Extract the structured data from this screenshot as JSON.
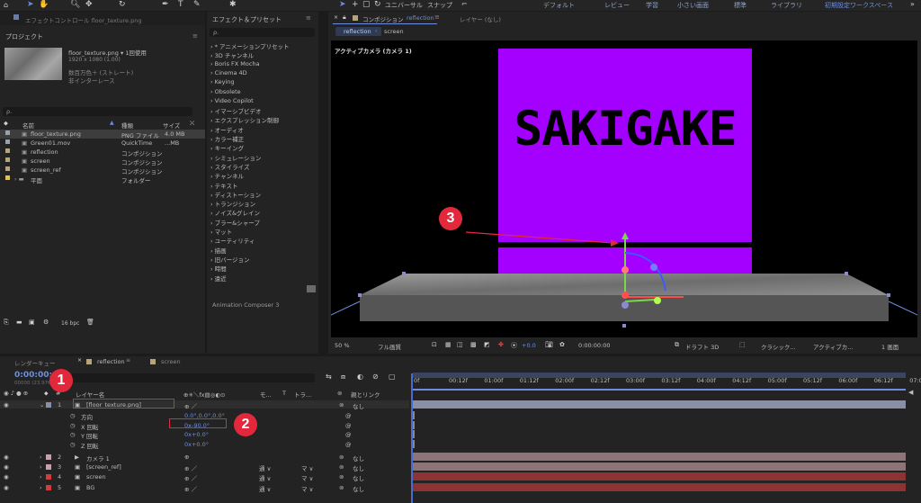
{
  "topbar": {
    "menu_universal": "ユニバーサル",
    "menu_snap": "スナップ",
    "workspaces": [
      "デフォルト",
      "レビュー",
      "学習",
      "小さい画面",
      "標準",
      "ライブラリ",
      "初期設定ワークスペース"
    ],
    "effect_control_tab": "エフェクトコントロール floor_texture.png"
  },
  "project": {
    "title": "プロジェクト",
    "file_name": "floor_texture.png ▾ 1回使用",
    "file_res": "1920 x 1080 (1.00)",
    "file_color": "数百万色＋ (ストレート)",
    "file_interlace": "非インターレース",
    "search_placeholder": "ρ.",
    "columns": {
      "name": "名前",
      "type": "種類",
      "size": "サイズ"
    },
    "items": [
      {
        "name": "floor_texture.png",
        "type": "PNG ファイル",
        "size": "4.0 MB",
        "color": "#9aa0ad",
        "selected": true
      },
      {
        "name": "Green01.mov",
        "type": "QuickTime",
        "size": "...MB",
        "color": "#9aa0ad"
      },
      {
        "name": "reflection",
        "type": "コンポジション",
        "size": "",
        "color": "#b8a47a"
      },
      {
        "name": "screen",
        "type": "コンポジション",
        "size": "",
        "color": "#b8a47a"
      },
      {
        "name": "screen_ref",
        "type": "コンポジション",
        "size": "",
        "color": "#b8a47a"
      },
      {
        "name": "平面",
        "type": "フォルダー",
        "size": "",
        "color": "#e0c34a"
      }
    ],
    "bpc": "16 bpc"
  },
  "effects": {
    "title": "エフェクト＆プリセット",
    "search_placeholder": "ρ.",
    "items": [
      "* アニメーションプリセット",
      "3D チャンネル",
      "Boris FX Mocha",
      "Cinema 4D",
      "Keying",
      "Obsolete",
      "Video Copilot",
      "イマーシブビデオ",
      "エクスプレッション制御",
      "オーディオ",
      "カラー補正",
      "キーイング",
      "シミュレーション",
      "スタイライズ",
      "チャンネル",
      "テキスト",
      "ディストーション",
      "トランジション",
      "ノイズ&グレイン",
      "ブラー&シャープ",
      "マット",
      "ユーティリティ",
      "描画",
      "旧バージョン",
      "時間",
      "遠近"
    ],
    "footer": "Animation Composer 3"
  },
  "viewer": {
    "tab_label": "コンポジション",
    "tab_comp": "reflection",
    "layer_tab": "レイヤー (なし)",
    "breadcrumb": [
      "reflection",
      "screen"
    ],
    "camera_label": "アクティブカメラ (カメラ 1)",
    "logo_text": "SAKIGAKE",
    "zoom": "50 %",
    "quality": "フル画質",
    "exposure": "+0.0",
    "timecode": "0:00:00:00",
    "renderer": "ドラフト 3D",
    "renderer_mode": "クラシック...",
    "view": "アクティブカ...",
    "views_count": "1 画面"
  },
  "timeline": {
    "render_queue": "レンダーキュー",
    "comp_tab": "reflection",
    "comp_tab2": "screen",
    "timecode": "0:00:00:00",
    "timecode_sub": "00000 (23.976 fps)",
    "col_layer_name": "レイヤー名",
    "col_mode": "モ...",
    "col_t": "T",
    "col_track": "トラ...",
    "col_parent": "親とリンク",
    "ruler": [
      "0f",
      "00:12f",
      "01:00f",
      "01:12f",
      "02:00f",
      "02:12f",
      "03:00f",
      "03:12f",
      "04:00f",
      "04:12f",
      "05:00f",
      "05:12f",
      "06:00f",
      "06:12f",
      "07:0"
    ],
    "layers": [
      {
        "num": "1",
        "name": "[floor_texture.png]",
        "color": "#8a8fa8",
        "parent": "なし"
      },
      {
        "num": "2",
        "name": "カメラ 1",
        "color": "#c9a0a8",
        "parent": "なし"
      },
      {
        "num": "3",
        "name": "[screen_ref]",
        "color": "#c9a0a8",
        "parent": "なし"
      },
      {
        "num": "4",
        "name": "screen",
        "color": "#d23c3c",
        "parent": "なし"
      },
      {
        "num": "5",
        "name": "BG",
        "color": "#d23c3c",
        "parent": "なし"
      }
    ],
    "props": [
      {
        "name": "方向",
        "value": "0.0°,0.0°,0.0°"
      },
      {
        "name": "X 回転",
        "value": "0x-90.0°"
      },
      {
        "name": "Y 回転",
        "value": "0x+0.0°"
      },
      {
        "name": "Z 回転",
        "value": "0x+0.0°"
      }
    ],
    "mode_value": "通 ∨",
    "mask_value": "マ ∨"
  },
  "callouts": [
    "1",
    "2",
    "3"
  ],
  "colors": {
    "purple": "#a300ff",
    "accent_blue": "#6d8ee0",
    "callout_red": "#e4283b"
  }
}
